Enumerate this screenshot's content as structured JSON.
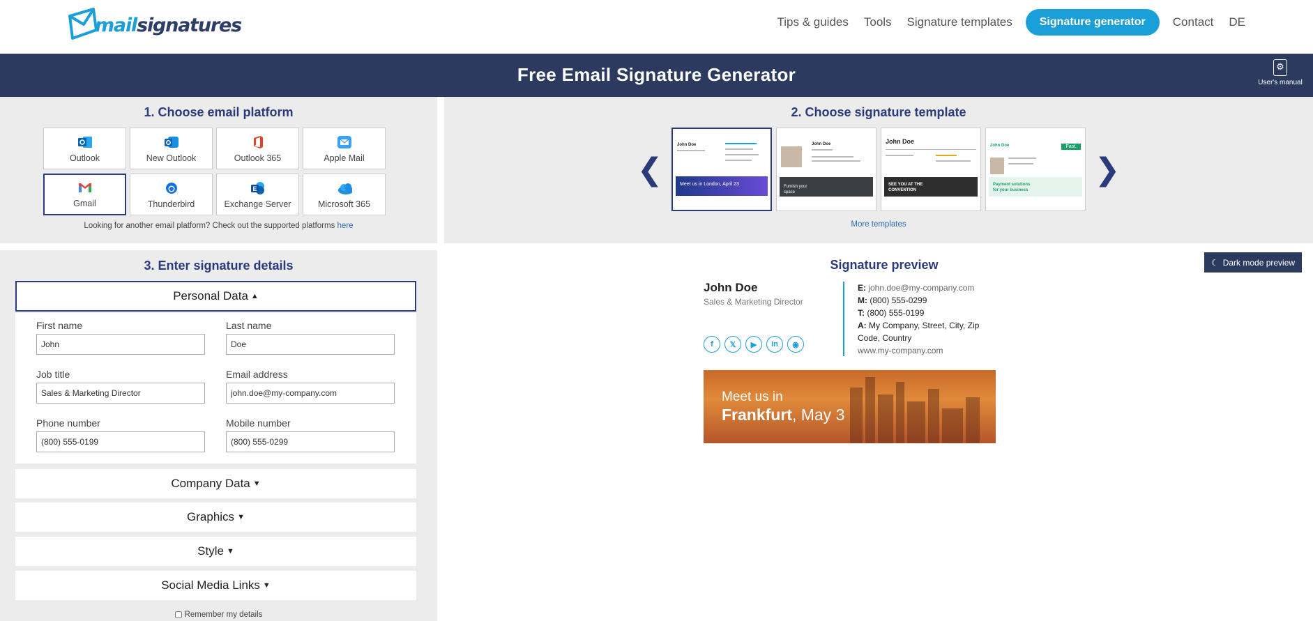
{
  "logo": {
    "mail": "mail",
    "signatures": "signatures"
  },
  "nav": {
    "links": [
      "Tips & guides",
      "Tools",
      "Signature templates"
    ],
    "cta": "Signature generator",
    "contact": "Contact",
    "lang": "DE"
  },
  "banner": {
    "title": "Free Email Signature Generator",
    "manual": "User's manual"
  },
  "platforms": {
    "heading": "1. Choose email platform",
    "items": [
      {
        "label": "Outlook",
        "icon": "outlook-icon"
      },
      {
        "label": "New Outlook",
        "icon": "new-outlook-icon"
      },
      {
        "label": "Outlook 365",
        "icon": "office-icon"
      },
      {
        "label": "Apple Mail",
        "icon": "apple-mail-icon"
      },
      {
        "label": "Gmail",
        "icon": "gmail-icon",
        "selected": true
      },
      {
        "label": "Thunderbird",
        "icon": "thunderbird-icon"
      },
      {
        "label": "Exchange Server",
        "icon": "exchange-icon"
      },
      {
        "label": "Microsoft 365",
        "icon": "cloud-icon"
      }
    ],
    "another_text": "Looking for another email platform? Check out the supported platforms",
    "another_link": "here"
  },
  "templates": {
    "heading": "2. Choose signature template",
    "items": [
      {
        "name": "John Doe",
        "banner_text": "Meet us in London, April 23"
      },
      {
        "name": "John Doe",
        "banner_text": "Furnish your space"
      },
      {
        "name": "John Doe",
        "banner_text": "SEE YOU AT THE CONVENTION"
      },
      {
        "name": "John Doe",
        "banner_text": "Payment solutions for your business",
        "tag": "Fast."
      }
    ],
    "more": "More templates"
  },
  "details": {
    "heading": "3. Enter signature details",
    "personal": "Personal Data",
    "fields": {
      "first_name": {
        "label": "First name",
        "value": "John"
      },
      "last_name": {
        "label": "Last name",
        "value": "Doe"
      },
      "job_title": {
        "label": "Job title",
        "value": "Sales & Marketing Director"
      },
      "email": {
        "label": "Email address",
        "value": "john.doe@my-company.com"
      },
      "phone": {
        "label": "Phone number",
        "value": "(800) 555-0199"
      },
      "mobile": {
        "label": "Mobile number",
        "value": "(800) 555-0299"
      }
    },
    "sections": [
      "Company Data",
      "Graphics",
      "Style",
      "Social Media Links"
    ],
    "remember": "Remember my details"
  },
  "preview": {
    "heading": "Signature preview",
    "dark_mode": "Dark mode preview",
    "name": "John Doe",
    "title": "Sales & Marketing Director",
    "email_label": "E:",
    "email": "john.doe@my-company.com",
    "mobile_label": "M:",
    "mobile": "(800) 555-0299",
    "phone_label": "T:",
    "phone": "(800) 555-0199",
    "address_label": "A:",
    "address": "My Company, Street, City, Zip Code, Country",
    "website": "www.my-company.com",
    "socials": [
      "facebook-icon",
      "x-icon",
      "youtube-icon",
      "linkedin-icon",
      "instagram-icon"
    ],
    "banner_line1": "Meet us in",
    "banner_city": "Frankfurt",
    "banner_date": ", May 3"
  },
  "colors": {
    "accent": "#1b9fd8",
    "navy": "#2b3a5e",
    "heading": "#2b3a7a",
    "panel": "#ececec"
  }
}
